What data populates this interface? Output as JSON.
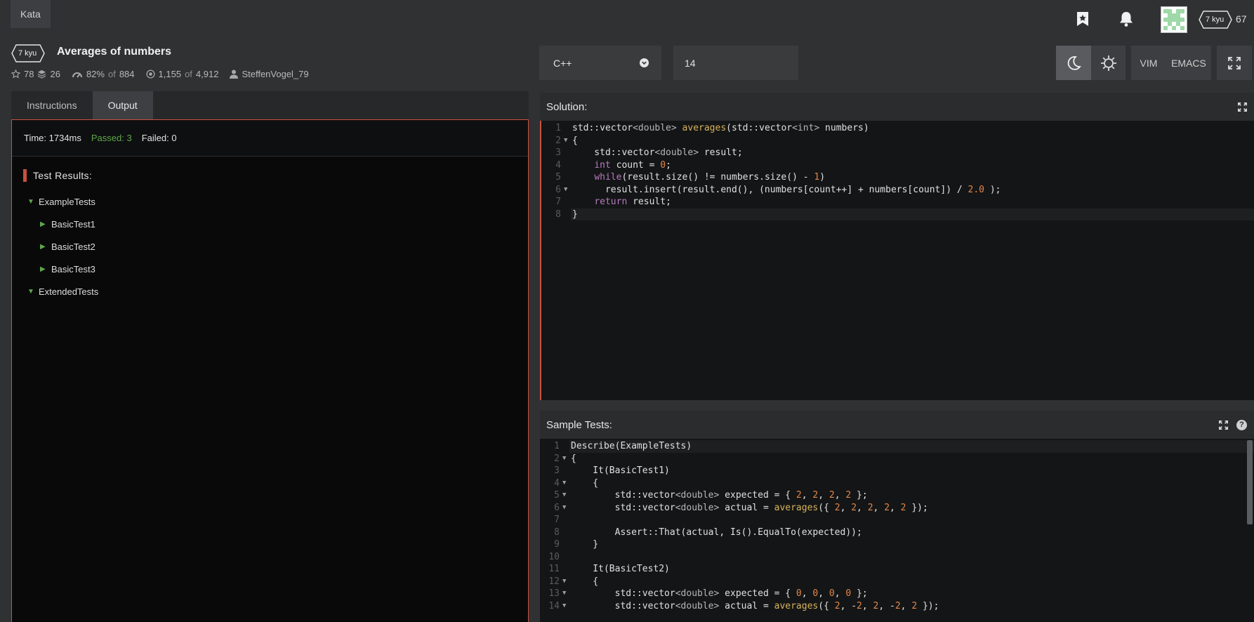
{
  "topbar": {
    "kata_tab": "Kata",
    "user_rank": "7 kyu",
    "user_honor": "67"
  },
  "kata": {
    "rank": "7 kyu",
    "title": "Averages of numbers",
    "stars": "78",
    "collections": "26",
    "satisfaction_pct": "82%",
    "satisfaction_of": "of",
    "satisfaction_votes": "884",
    "completed": "1,155",
    "completed_of": "of",
    "attempted": "4,912",
    "author": "SteffenVogel_79"
  },
  "editor": {
    "language": "C++",
    "version": "14",
    "vim_label": "VIM",
    "emacs_label": "EMACS"
  },
  "left": {
    "tabs": [
      "Instructions",
      "Output"
    ],
    "active_tab": "Output",
    "time": "Time: 1734ms",
    "passed": "Passed: 3",
    "failed": "Failed: 0",
    "results_title": "Test Results:",
    "tree": [
      {
        "label": "ExampleTests",
        "level": 0,
        "expanded": true
      },
      {
        "label": "BasicTest1",
        "level": 1,
        "expanded": false
      },
      {
        "label": "BasicTest2",
        "level": 1,
        "expanded": false
      },
      {
        "label": "BasicTest3",
        "level": 1,
        "expanded": false
      },
      {
        "label": "ExtendedTests",
        "level": 0,
        "expanded": true
      }
    ]
  },
  "solution": {
    "title": "Solution:",
    "lines": [
      "std::vector<double> averages(std::vector<int> numbers)",
      "{",
      "    std::vector<double> result;",
      "    int count = 0;",
      "    while(result.size() != numbers.size() - 1)",
      "      result.insert(result.end(), (numbers[count++] + numbers[count]) / 2.0 );",
      "    return result;",
      "}"
    ],
    "folds": [
      false,
      true,
      false,
      false,
      false,
      true,
      false,
      false
    ]
  },
  "tests": {
    "title": "Sample Tests:",
    "lines": [
      "Describe(ExampleTests)",
      "{",
      "    It(BasicTest1)",
      "    {",
      "        std::vector<double> expected = { 2, 2, 2, 2 };",
      "        std::vector<double> actual = averages({ 2, 2, 2, 2, 2 });",
      "",
      "        Assert::That(actual, Is().EqualTo(expected));",
      "    }",
      "",
      "    It(BasicTest2)",
      "    {",
      "        std::vector<double> expected = { 0, 0, 0, 0 };",
      "        std::vector<double> actual = averages({ 2, -2, 2, -2, 2 });"
    ],
    "folds": [
      false,
      true,
      false,
      true,
      true,
      true,
      false,
      false,
      false,
      false,
      false,
      true,
      true,
      true
    ]
  },
  "colors": {
    "accent_red": "#c9513f",
    "passed_green": "#5fa84a"
  }
}
